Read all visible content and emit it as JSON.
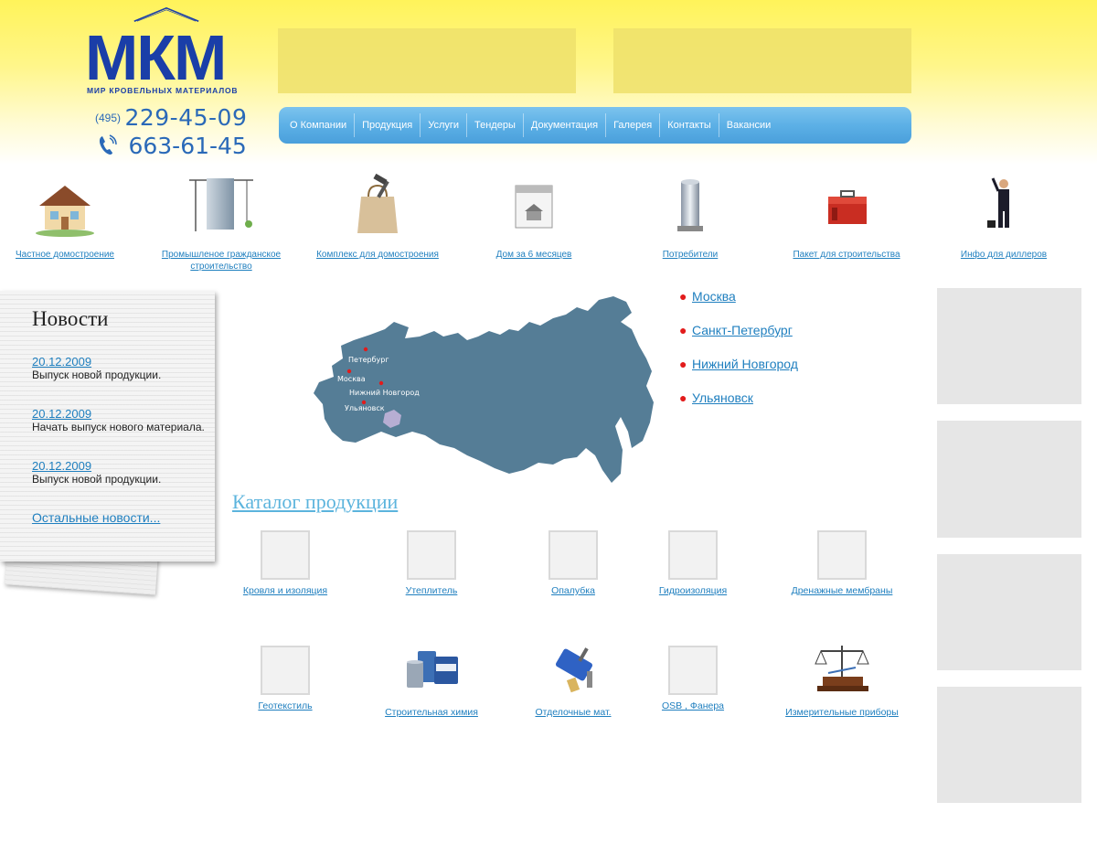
{
  "header": {
    "logo_text": "МКМ",
    "logo_subtitle": "МИР КРОВЕЛЬНЫХ МАТЕРИАЛОВ",
    "phone1_code": "(495)",
    "phone1_number": "229-45-09",
    "phone2_number": "663-61-45"
  },
  "nav": {
    "items": [
      "О Компании",
      "Продукция",
      "Услуги",
      "Тендеры",
      "Документация",
      "Галерея",
      "Контакты",
      "Вакансии"
    ]
  },
  "categories": [
    {
      "label": "Частное домостроение",
      "icon": "house-icon"
    },
    {
      "label": "Промышленое гражданское строительство",
      "icon": "building-crane-icon"
    },
    {
      "label": "Комплекс для домостроения",
      "icon": "shopping-bag-tools-icon"
    },
    {
      "label": "Дом за 6 месяцев",
      "icon": "calendar-house-icon"
    },
    {
      "label": "Потребители",
      "icon": "cylinder-tower-icon"
    },
    {
      "label": "Пакет для строительства",
      "icon": "toolbox-icon"
    },
    {
      "label": "Инфо для диллеров",
      "icon": "businessman-icon"
    }
  ],
  "news": {
    "title": "Новости",
    "items": [
      {
        "date": "20.12.2009",
        "text": "Выпуск новой продукции."
      },
      {
        "date": "20.12.2009",
        "text": "Начать выпуск нового материала."
      },
      {
        "date": "20.12.2009",
        "text": "Выпуск новой продукции."
      }
    ],
    "more": "Остальные новости..."
  },
  "map": {
    "labels": [
      "Петербург",
      "Москва",
      "Нижний Новгород",
      "Ульяновск"
    ],
    "fill_color": "#557d96",
    "highlight_color": "#b7aed3",
    "dot_color": "#e21b1b"
  },
  "cities": [
    "Москва",
    "Санкт-Петербург",
    "Нижний Новгород",
    "Ульяновск"
  ],
  "catalog": {
    "title": "Каталог продукции",
    "items": [
      {
        "label": "Кровля и изоляция",
        "image": "placeholder"
      },
      {
        "label": "Утеплитель",
        "image": "placeholder"
      },
      {
        "label": "Опалубка",
        "image": "placeholder"
      },
      {
        "label": "Гидроизоляция",
        "image": "placeholder"
      },
      {
        "label": "Дренажные мембраны",
        "image": "placeholder"
      },
      {
        "label": "Геотекстиль",
        "image": "placeholder"
      },
      {
        "label": "Строительная химия",
        "image": "paint-buckets-icon"
      },
      {
        "label": "Отделочные мат.",
        "image": "paint-roller-icon"
      },
      {
        "label": "OSB , Фанера",
        "image": "placeholder"
      },
      {
        "label": "Измерительные приборы",
        "image": "scales-icon"
      }
    ]
  },
  "colors": {
    "header_yellow": "#fff35a",
    "nav_blue": "#5cb0e6",
    "link_blue": "#1f7fbf",
    "logo_blue": "#1a3ea8"
  }
}
